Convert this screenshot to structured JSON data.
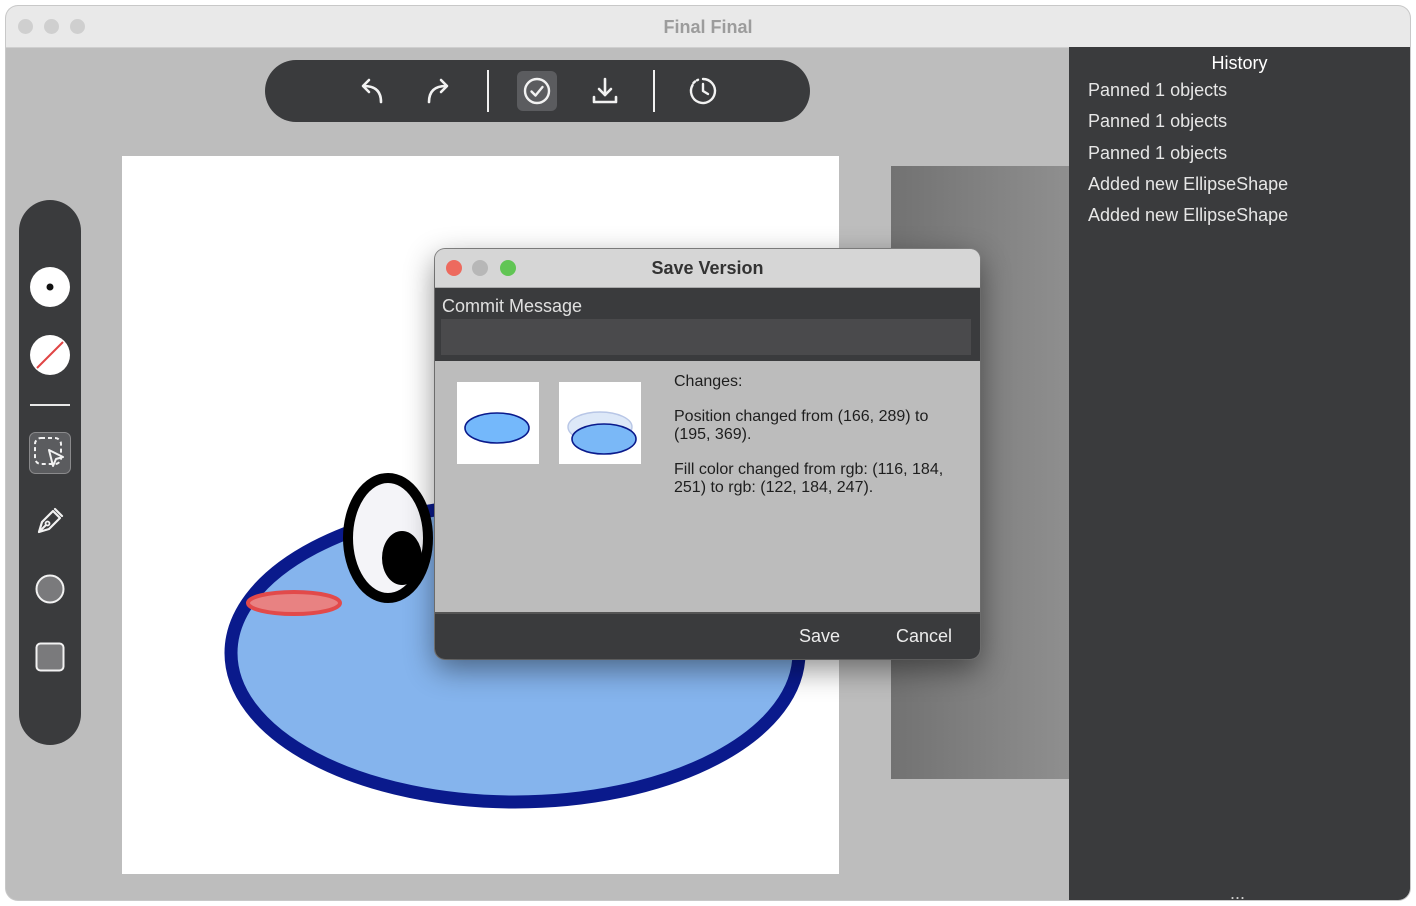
{
  "window": {
    "title": "Final Final"
  },
  "toolbar": {
    "undo_icon": "undo-arrow-icon",
    "redo_icon": "redo-arrow-icon",
    "commit_icon": "check-circle-icon",
    "download_icon": "download-icon",
    "history_icon": "clock-history-icon"
  },
  "tools": {
    "items": [
      "fill-color-dot-icon",
      "no-stroke-icon",
      "select-pointer-icon",
      "pen-tool-icon",
      "ellipse-tool-icon",
      "rectangle-tool-icon"
    ]
  },
  "history": {
    "title": "History",
    "items": [
      "Panned 1 objects",
      "Panned 1 objects",
      "Panned 1 objects",
      "Added new EllipseShape",
      "Added new EllipseShape"
    ],
    "more": "..."
  },
  "dialog": {
    "title": "Save Version",
    "commit_label": "Commit Message",
    "commit_value": "",
    "changes_heading": "Changes:",
    "change_1": "Position changed from (166, 289) to (195, 369).",
    "change_2": "Fill color changed from rgb: (116, 184, 251) to rgb: (122, 184, 247).",
    "save_label": "Save",
    "cancel_label": "Cancel"
  },
  "colors": {
    "ellipse_fill": "#85b4ed",
    "ellipse_stroke": "#0a1a8c",
    "blush": "#e86868",
    "panel_dark": "#3a3b3d"
  }
}
